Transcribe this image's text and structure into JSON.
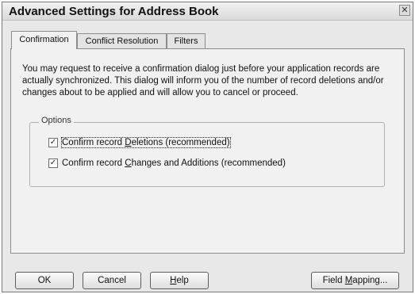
{
  "window": {
    "title": "Advanced Settings for Address Book",
    "close_glyph": "✕"
  },
  "tabs": [
    {
      "label": "Confirmation",
      "active": true
    },
    {
      "label": "Conflict Resolution",
      "active": false
    },
    {
      "label": "Filters",
      "active": false
    }
  ],
  "confirmation": {
    "intro": "You may request to receive a confirmation dialog just before your application records are actually synchronized.  This dialog will inform you of the number of record deletions and/or changes about to be applied and will allow you to cancel or proceed.",
    "options_legend": "Options",
    "options": [
      {
        "pre": "Confirm record ",
        "mnemonic": "D",
        "post": "eletions (recommended)",
        "checked": true
      },
      {
        "pre": "Confirm record ",
        "mnemonic": "C",
        "post": "hanges and Additions (recommended)",
        "checked": true
      }
    ],
    "check_glyph": "✓"
  },
  "buttons": {
    "ok": "OK",
    "cancel": "Cancel",
    "help_mnemonic": "H",
    "help_rest": "elp",
    "field_mapping_pre": "Field ",
    "field_mapping_mnemonic": "M",
    "field_mapping_post": "apping..."
  }
}
